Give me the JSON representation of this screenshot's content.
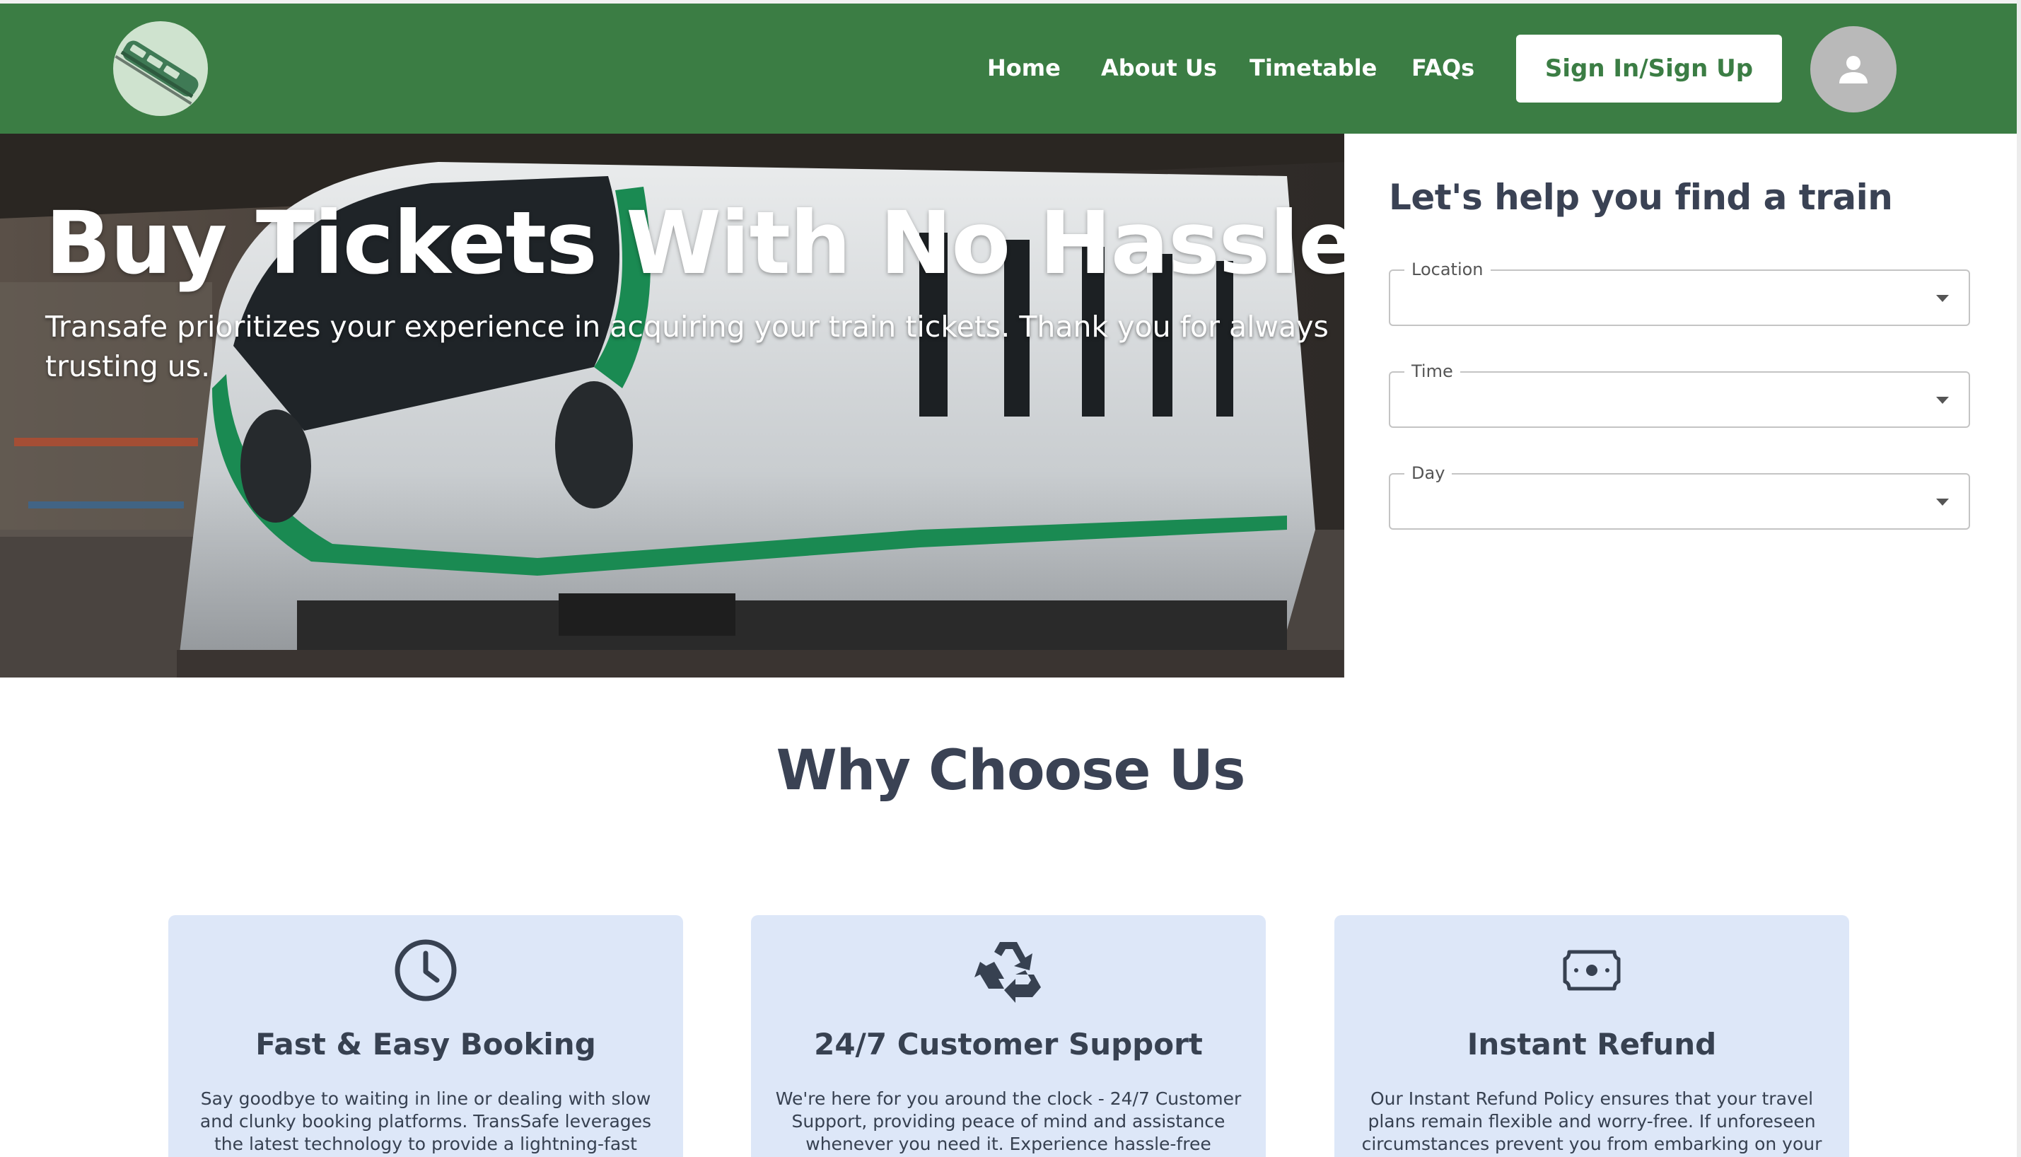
{
  "nav": {
    "logo_icon": "train-logo-icon",
    "links": [
      "Home",
      "About Us",
      "Timetable",
      "FAQs"
    ],
    "signin_label": "Sign In/Sign Up",
    "avatar_icon": "user-icon",
    "brand_color": "#3b7d44"
  },
  "hero": {
    "title": "Buy Tickets With No Hassles",
    "subtitle": "Transafe prioritizes your experience in acquiring your train tickets. Thank you for always trusting us."
  },
  "finder": {
    "title": "Let's help you find a train",
    "fields": [
      {
        "label": "Location",
        "value": ""
      },
      {
        "label": "Time",
        "value": ""
      },
      {
        "label": "Day",
        "value": ""
      }
    ]
  },
  "why": {
    "title": "Why Choose Us",
    "cards": [
      {
        "icon": "clock-icon",
        "title": "Fast & Easy Booking",
        "text": "Say goodbye to waiting in line or dealing with slow and clunky booking platforms. TransSafe leverages the latest technology to provide a lightning-fast booking"
      },
      {
        "icon": "recycle-icon",
        "title": "24/7 Customer Support",
        "text": "We're here for you around the clock - 24/7 Customer Support, providing peace of mind and assistance whenever you need it. Experience hassle-free journeys"
      },
      {
        "icon": "money-icon",
        "title": "Instant Refund",
        "text": "Our Instant Refund Policy ensures that your travel plans remain flexible and worry-free. If unforeseen circumstances prevent you from embarking on your"
      }
    ],
    "card_color": "#dde7f8"
  }
}
